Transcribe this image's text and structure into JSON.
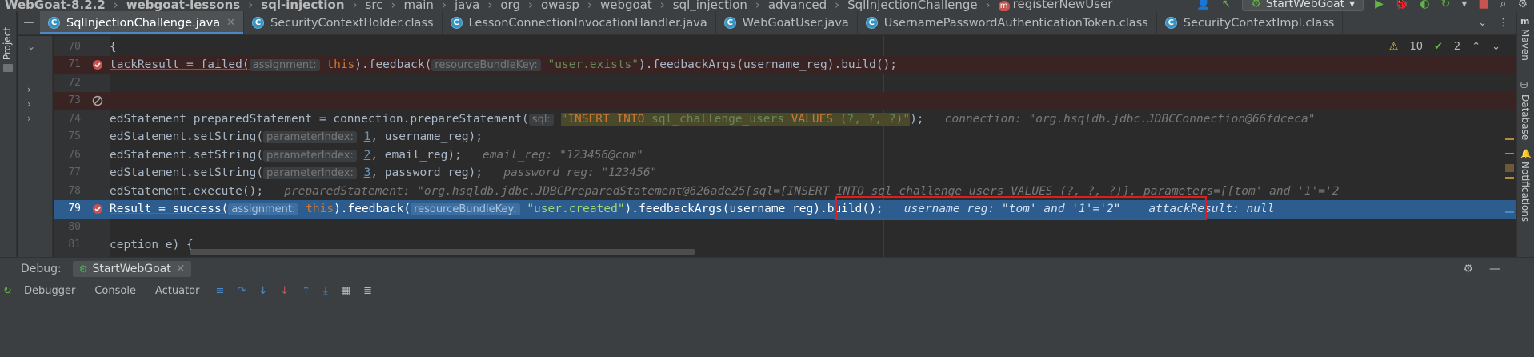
{
  "breadcrumb": {
    "items": [
      "WebGoat-8.2.2",
      "webgoat-lessons",
      "sql-injection",
      "src",
      "main",
      "java",
      "org",
      "owasp",
      "webgoat",
      "sql_injection",
      "advanced",
      "SqlInjectionChallenge",
      "registerNewUser"
    ],
    "method_badge": "m"
  },
  "toolbar": {
    "run_config": "StartWebGoat"
  },
  "left_strip": {
    "label": "Project"
  },
  "right_strip": {
    "items": [
      "Maven",
      "Database",
      "Notifications"
    ],
    "maven_icon": "m"
  },
  "tabs": [
    {
      "label": "SqlInjectionChallenge.java",
      "icon": "C"
    },
    {
      "label": "SecurityContextHolder.class",
      "icon": "C"
    },
    {
      "label": "LessonConnectionInvocationHandler.java",
      "icon": "C"
    },
    {
      "label": "WebGoatUser.java",
      "icon": "C"
    },
    {
      "label": "UsernamePasswordAuthenticationToken.class",
      "icon": "C"
    },
    {
      "label": "SecurityContextImpl.class",
      "icon": "C"
    }
  ],
  "editor": {
    "warnings": {
      "warn_count": "10",
      "ok_count": "2"
    },
    "lines": [
      {
        "num": "70",
        "text": "{"
      },
      {
        "num": "71",
        "pre": "tackResult = failed(",
        "hint1": "assignment:",
        "kw": "this",
        "mid": ").feedback(",
        "hint2": "resourceBundleKey:",
        "str": "\"user.exists\"",
        "post": ").feedbackArgs(username_reg).build();"
      },
      {
        "num": "72",
        "text": ""
      },
      {
        "num": "73",
        "text": ""
      },
      {
        "num": "74",
        "pre": "edStatement preparedStatement = connection.prepareStatement(",
        "hint": "sql:",
        "str_a": "\"",
        "str_kw1": "INSERT INTO",
        "str_b": " sql_challenge_users ",
        "str_kw2": "VALUES",
        "str_c": " (?, ?, ?)\"",
        "post": ");",
        "inline": "connection: \"org.hsqldb.jdbc.JDBCConnection@66fdceca\""
      },
      {
        "num": "75",
        "pre": "edStatement.setString(",
        "hint": "parameterIndex:",
        "n": "1",
        "post": ", username_reg);"
      },
      {
        "num": "76",
        "pre": "edStatement.setString(",
        "hint": "parameterIndex:",
        "n": "2",
        "post": ", email_reg);",
        "inline": "email_reg: \"123456@com\""
      },
      {
        "num": "77",
        "pre": "edStatement.setString(",
        "hint": "parameterIndex:",
        "n": "3",
        "post": ", password_reg);",
        "inline": "password_reg: \"123456\""
      },
      {
        "num": "78",
        "pre": "edStatement.execute();",
        "inline": "preparedStatement: \"org.hsqldb.jdbc.JDBCPreparedStatement@626ade25[sql=[INSERT INTO sql_challenge_users VALUES (?, ?, ?)], parameters=[[tom' and '1'='2"
      },
      {
        "num": "79",
        "pre": "Result = success(",
        "hint1": "assignment:",
        "kw": "this",
        "mid": ").feedback(",
        "hint2": "resourceBundleKey:",
        "str": "\"user.created\"",
        "post": ").feedbackArgs(username_reg).build();",
        "inline1": "username_reg: \"tom' and '1'='2\"",
        "inline2": "attackResult: null"
      },
      {
        "num": "80",
        "text": ""
      },
      {
        "num": "81",
        "text": "ception e) {"
      }
    ]
  },
  "debug": {
    "title": "Debug:",
    "session": "StartWebGoat",
    "tools": [
      "Debugger",
      "Console",
      "Actuator"
    ]
  },
  "colors": {
    "accent": "#4a88c7",
    "exec_line": "#2d5c8f",
    "highlight_box": "#e21c1c",
    "error_line": "#3a2323"
  }
}
